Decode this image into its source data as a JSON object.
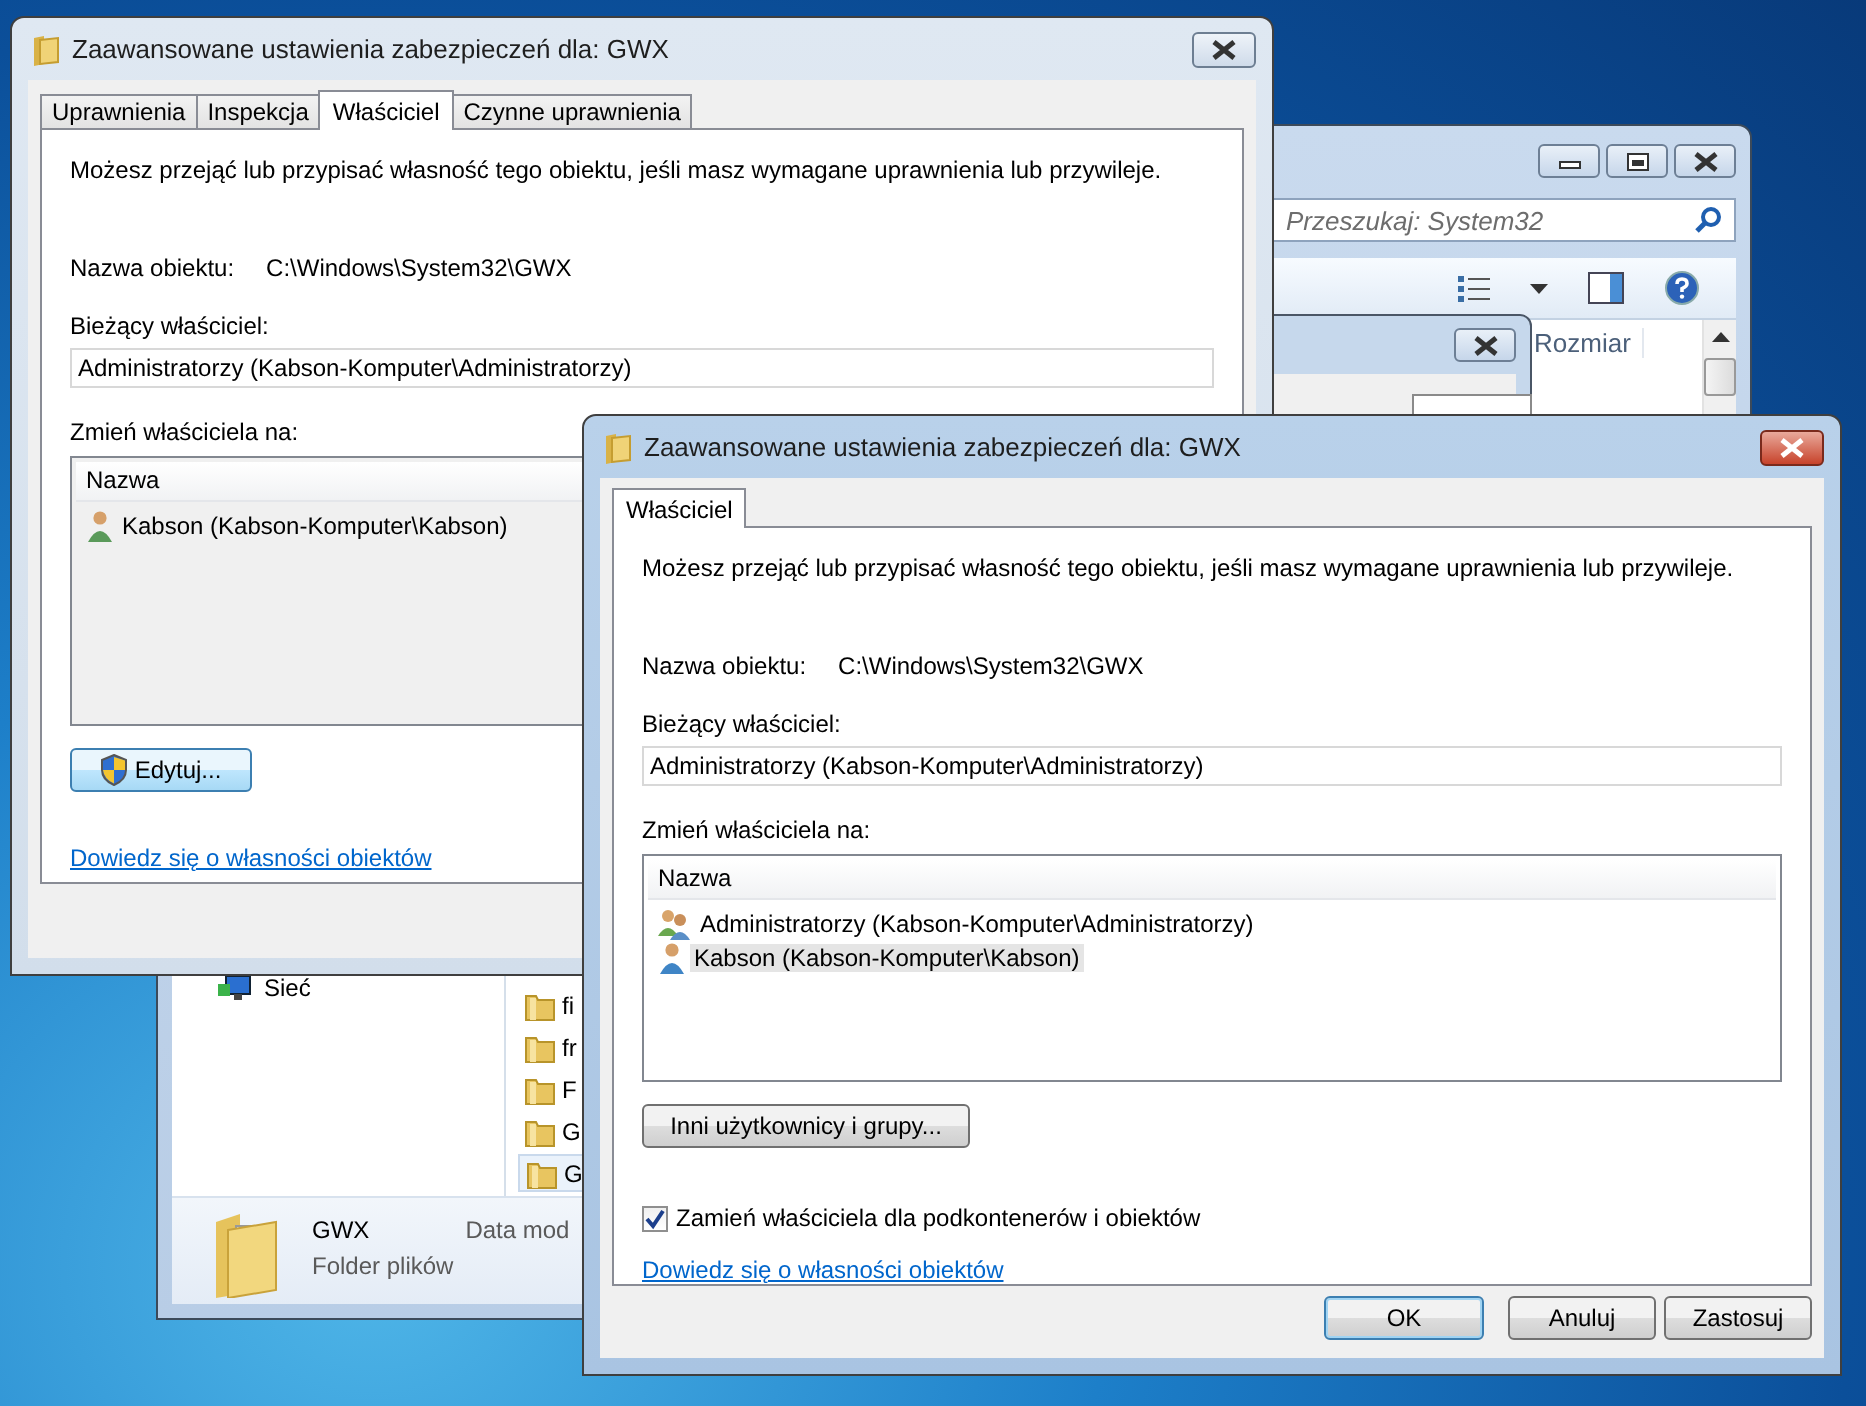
{
  "explorer": {
    "search": {
      "placeholder": "Przeszukaj: System32"
    },
    "columns": [
      "Rozmiar"
    ],
    "nav_items": [
      {
        "label": "Sieć"
      }
    ],
    "files": [
      {
        "name": "fi",
        "selected": false
      },
      {
        "name": "fr",
        "selected": false
      },
      {
        "name": "F",
        "selected": false
      },
      {
        "name": "G",
        "selected": false
      },
      {
        "name": "G",
        "selected": true
      }
    ],
    "details": {
      "name": "GWX",
      "type": "Folder plików",
      "field_label": "Data mod"
    }
  },
  "dialogs": [
    {
      "title": "Zaawansowane ustawienia zabezpieczeń dla: GWX",
      "active": false,
      "tabs": [
        {
          "label": "Uprawnienia",
          "selected": false
        },
        {
          "label": "Inspekcja",
          "selected": false
        },
        {
          "label": "Właściciel",
          "selected": true
        },
        {
          "label": "Czynne uprawnienia",
          "selected": false
        }
      ],
      "intro": "Możesz przejąć lub przypisać własność tego obiektu, jeśli masz wymagane uprawnienia lub przywileje.",
      "object_label": "Nazwa obiektu:",
      "object_value": "C:\\Windows\\System32\\GWX",
      "owner_label": "Bieżący właściciel:",
      "owner_value": "Administratorzy (Kabson-Komputer\\Administratorzy)",
      "change_label": "Zmień właściciela na:",
      "list": {
        "header": "Nazwa",
        "disabled": true,
        "users": [
          {
            "name": "Kabson (Kabson-Komputer\\Kabson)",
            "kind": "user",
            "selected": false
          }
        ]
      },
      "action_button": {
        "label": "Edytuj...",
        "shield": true
      },
      "link": "Dowiedz się o własności obiektów"
    },
    {
      "title": "Zaawansowane ustawienia zabezpieczeń dla: GWX",
      "active": true,
      "tabs": [
        {
          "label": "Właściciel",
          "selected": true
        }
      ],
      "intro": "Możesz przejąć lub przypisać własność tego obiektu, jeśli masz wymagane uprawnienia lub przywileje.",
      "object_label": "Nazwa obiektu:",
      "object_value": "C:\\Windows\\System32\\GWX",
      "owner_label": "Bieżący właściciel:",
      "owner_value": "Administratorzy (Kabson-Komputer\\Administratorzy)",
      "change_label": "Zmień właściciela na:",
      "list": {
        "header": "Nazwa",
        "disabled": false,
        "users": [
          {
            "name": "Administratorzy (Kabson-Komputer\\Administratorzy)",
            "kind": "group",
            "selected": false
          },
          {
            "name": "Kabson (Kabson-Komputer\\Kabson)",
            "kind": "user",
            "selected": true
          }
        ]
      },
      "action_button": {
        "label": "Inni użytkownicy i grupy...",
        "shield": false
      },
      "checkbox": {
        "label": "Zamień właściciela dla podkontenerów i obiektów",
        "checked": true
      },
      "link": "Dowiedz się o własności obiektów",
      "buttons": [
        {
          "label": "OK",
          "default": true
        },
        {
          "label": "Anuluj",
          "default": false
        },
        {
          "label": "Zastosuj",
          "default": false
        }
      ]
    }
  ]
}
